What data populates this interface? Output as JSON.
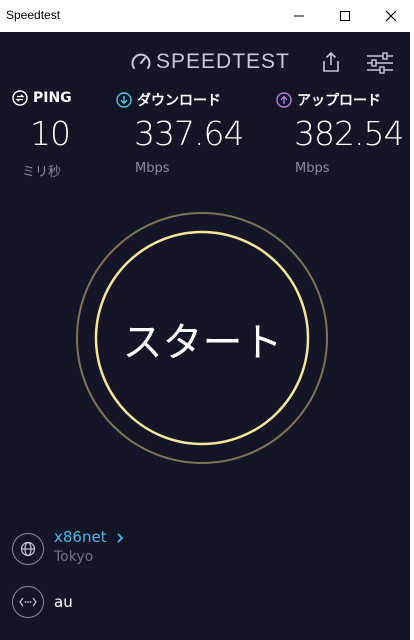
{
  "window": {
    "title": "Speedtest",
    "controls": {
      "minimize": "minimize-icon",
      "maximize": "maximize-icon",
      "close": "close-icon"
    }
  },
  "header": {
    "logo_text": "SPEEDTEST",
    "share": "share-icon",
    "settings": "settings-sliders-icon"
  },
  "metrics": {
    "ping": {
      "label": "PING",
      "value": "10",
      "unit": "ミリ秒",
      "color": "#ffffff"
    },
    "download": {
      "label": "ダウンロード",
      "value": "337.64",
      "unit": "Mbps",
      "color": "#4fc6e0"
    },
    "upload": {
      "label": "アップロード",
      "value": "382.54",
      "unit": "Mbps",
      "color": "#b47ee8"
    }
  },
  "start_button": {
    "label": "スタート",
    "inner_ring": "#f3e79a",
    "outer_ring": "#7e7558"
  },
  "server": {
    "name": "x86net",
    "location": "Tokyo",
    "chevron": "chevron-right-icon"
  },
  "connection": {
    "carrier": "au",
    "icon": "connection-icon"
  }
}
